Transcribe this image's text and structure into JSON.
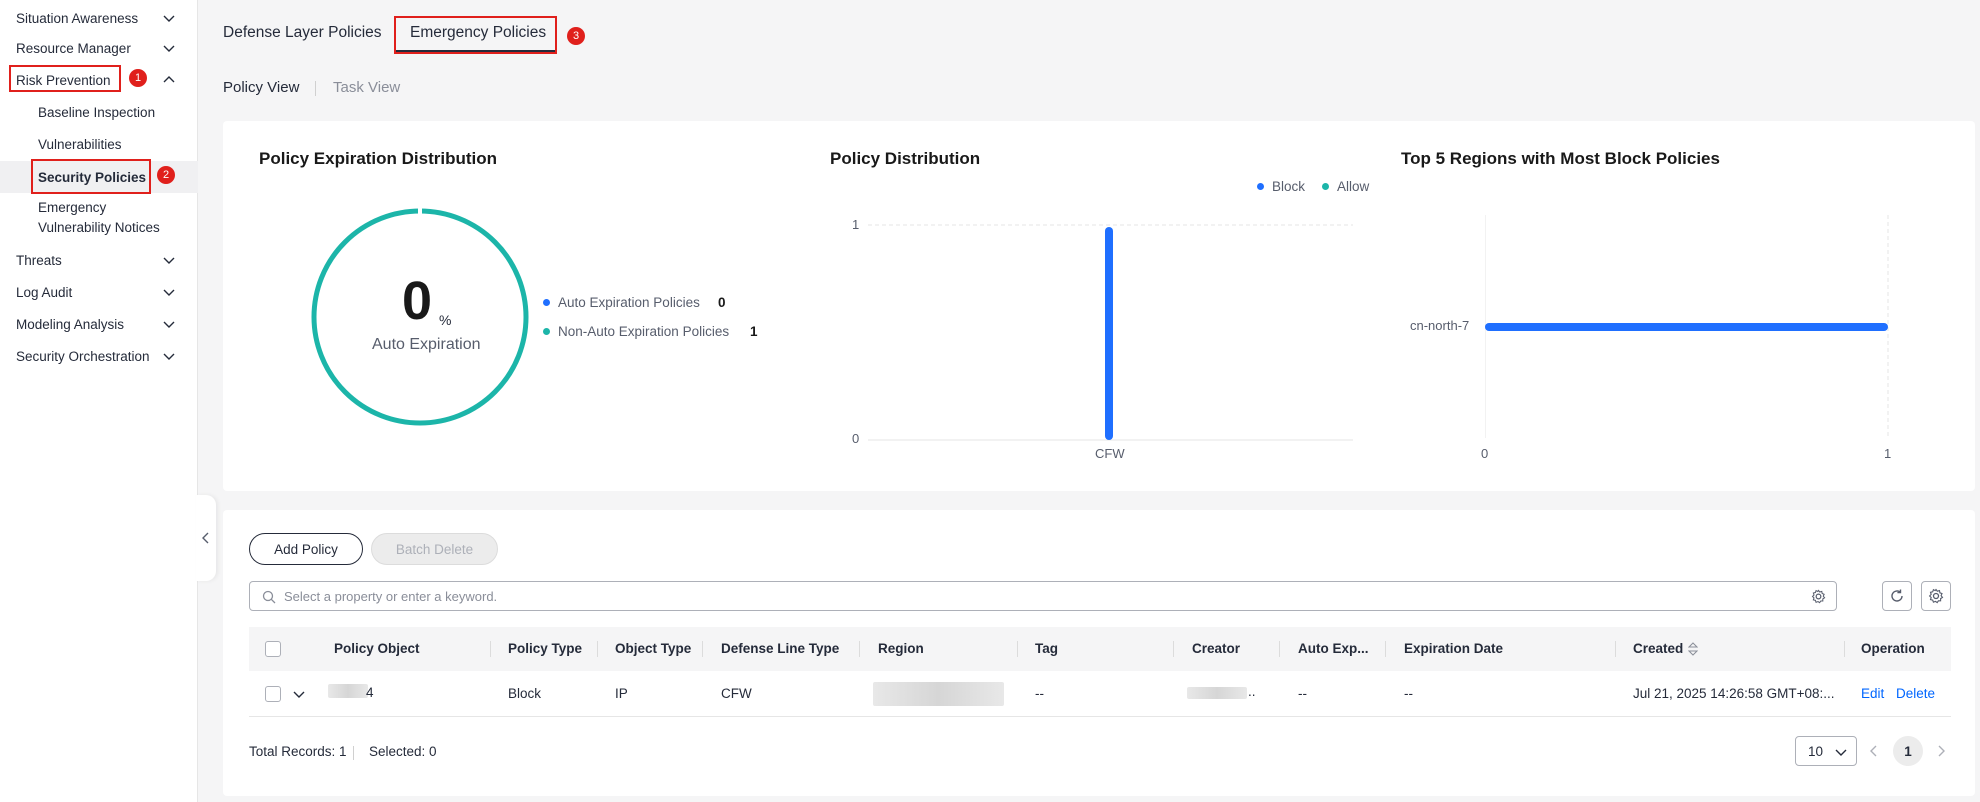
{
  "sidebar": {
    "items": [
      {
        "label": "Situation Awareness"
      },
      {
        "label": "Resource Manager"
      },
      {
        "label": "Risk Prevention"
      },
      {
        "label": "Threats"
      },
      {
        "label": "Log Audit"
      },
      {
        "label": "Modeling Analysis"
      },
      {
        "label": "Security Orchestration"
      }
    ],
    "risk_prevention_children": [
      {
        "label": "Baseline Inspection"
      },
      {
        "label": "Vulnerabilities"
      },
      {
        "label": "Security Policies"
      },
      {
        "label": "Emergency",
        "label2": "Vulnerability Notices"
      }
    ],
    "badges": [
      "1",
      "2"
    ]
  },
  "tabs": {
    "defense": "Defense Layer Policies",
    "emergency": "Emergency Policies",
    "badge": "3"
  },
  "views": {
    "policy": "Policy View",
    "task": "Task View"
  },
  "charts": {
    "expiration": {
      "title": "Policy Expiration Distribution",
      "big_value": "0",
      "unit": "%",
      "caption": "Auto Expiration",
      "legend": [
        {
          "label": "Auto Expiration Policies",
          "value": "0",
          "color": "#1f6fff"
        },
        {
          "label": "Non-Auto Expiration Policies",
          "value": "1",
          "color": "#1cb5a9"
        }
      ]
    },
    "distribution": {
      "title": "Policy Distribution",
      "legend": [
        {
          "label": "Block",
          "color": "#1f6fff"
        },
        {
          "label": "Allow",
          "color": "#1cb5a9"
        }
      ],
      "y_ticks": [
        "1",
        "0"
      ],
      "category": "CFW"
    },
    "regions": {
      "title": "Top 5 Regions with Most Block Policies",
      "category": "cn-north-7",
      "x_ticks": [
        "0",
        "1"
      ]
    }
  },
  "chart_data": [
    {
      "type": "pie",
      "title": "Policy Expiration Distribution",
      "categories": [
        "Auto Expiration Policies",
        "Non-Auto Expiration Policies"
      ],
      "values": [
        0,
        1
      ]
    },
    {
      "type": "bar",
      "title": "Policy Distribution",
      "categories": [
        "CFW"
      ],
      "series": [
        {
          "name": "Block",
          "values": [
            1
          ]
        },
        {
          "name": "Allow",
          "values": [
            0
          ]
        }
      ],
      "ylim": [
        0,
        1
      ]
    },
    {
      "type": "bar",
      "title": "Top 5 Regions with Most Block Policies",
      "categories": [
        "cn-north-7"
      ],
      "values": [
        1
      ],
      "xlim": [
        0,
        1
      ]
    }
  ],
  "toolbar": {
    "add": "Add Policy",
    "batch_delete": "Batch Delete",
    "search_placeholder": "Select a property or enter a keyword."
  },
  "table": {
    "columns": [
      "Policy Object",
      "Policy Type",
      "Object Type",
      "Defense Line Type",
      "Region",
      "Tag",
      "Creator",
      "Auto Exp...",
      "Expiration Date",
      "Created",
      "Operation"
    ],
    "row": {
      "policy_object": "4",
      "policy_type": "Block",
      "object_type": "IP",
      "defense_line": "CFW",
      "tag": "--",
      "creator_suffix": "..",
      "auto_exp": "--",
      "expiration": "--",
      "created": "Jul 21, 2025 14:26:58 GMT+08:...",
      "edit": "Edit",
      "delete": "Delete"
    }
  },
  "footer": {
    "total": "Total Records: 1",
    "selected": "Selected: 0",
    "page_size": "10",
    "page": "1"
  }
}
